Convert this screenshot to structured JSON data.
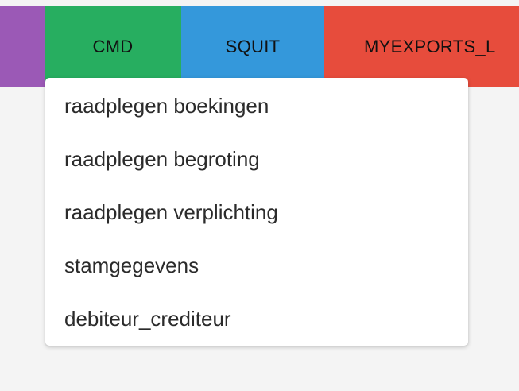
{
  "topbar": {
    "tabs": [
      {
        "label": "",
        "color": "#9b59b6"
      },
      {
        "label": "CMD",
        "color": "#27ae60"
      },
      {
        "label": "SQUIT",
        "color": "#3498db"
      },
      {
        "label": "MYEXPORTS_L",
        "color": "#e74c3c"
      }
    ]
  },
  "dropdown": {
    "items": [
      {
        "label": "raadplegen boekingen"
      },
      {
        "label": "raadplegen begroting"
      },
      {
        "label": "raadplegen verplichting"
      },
      {
        "label": "stamgegevens"
      },
      {
        "label": "debiteur_crediteur"
      }
    ]
  }
}
